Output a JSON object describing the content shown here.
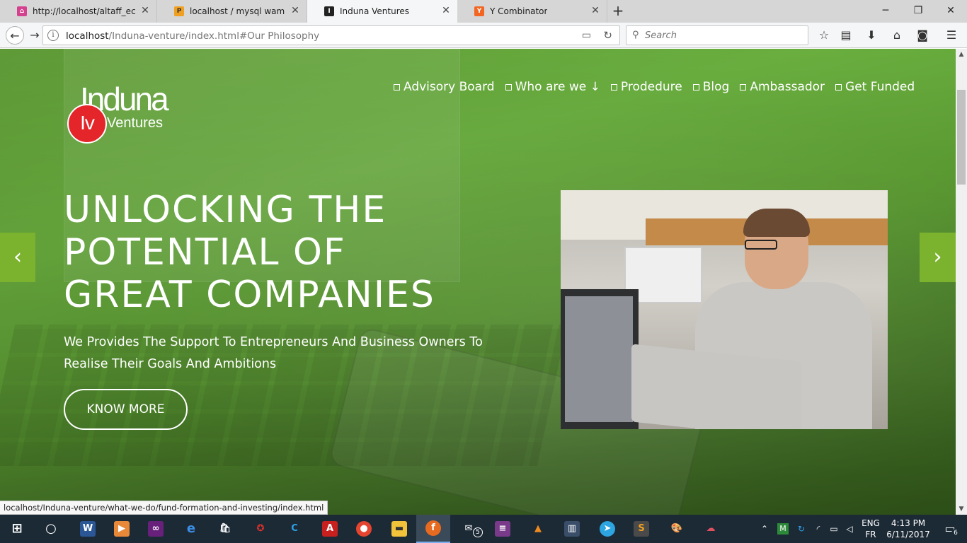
{
  "browser": {
    "tabs": [
      {
        "label": "http://localhost/altaff_ecom",
        "favicon": "app-icon",
        "color": "#d4418e",
        "active": false
      },
      {
        "label": "localhost / mysql wampserv",
        "favicon": "phpmyadmin-icon",
        "color": "#f0a020",
        "active": false
      },
      {
        "label": "Induna Ventures",
        "favicon": "induna-icon",
        "color": "#222222",
        "active": true
      },
      {
        "label": "Y Combinator",
        "favicon": "ycombinator-icon",
        "color": "#f26522",
        "active": false
      }
    ],
    "new_tab_label": "+",
    "url_host": "localhost",
    "url_path": "/Induna-venture/index.html#Our Philosophy",
    "search_placeholder": "Search",
    "status_url": "localhost/Induna-venture/what-we-do/fund-formation-and-investing/index.html"
  },
  "site": {
    "logo_word": "Induna",
    "logo_sub": "Ventures",
    "logo_badge": "Iv",
    "nav": [
      {
        "label": "Advisory Board"
      },
      {
        "label": "Who are we ↓"
      },
      {
        "label": "Prodedure"
      },
      {
        "label": "Blog"
      },
      {
        "label": "Ambassador"
      },
      {
        "label": "Get Funded"
      }
    ],
    "hero_lines": [
      "UNLOCKING THE",
      "POTENTIAL OF",
      "GREAT COMPANIES"
    ],
    "hero_sub": "We Provides The Support To Entrepreneurs And Business Owners To Realise Their Goals And Ambitions",
    "cta_label": "KNOW MORE",
    "arrow_left": "‹",
    "arrow_right": "›"
  },
  "taskbar": {
    "apps": [
      "windows-start-icon",
      "cortana-icon",
      "word-icon",
      "media-player-icon",
      "visual-studio-icon",
      "edge-icon",
      "store-icon",
      "antivirus-icon",
      "ccleaner-icon",
      "acrobat-icon",
      "chrome-icon",
      "file-explorer-icon",
      "firefox-icon",
      "mail-icon",
      "winrar-icon",
      "vlc-icon",
      "app-icon",
      "telegram-icon",
      "sublime-icon",
      "paint-icon",
      "remote-icon"
    ],
    "mail_count": "5",
    "lang_top": "ENG",
    "lang_bottom": "FR",
    "time": "4:13 PM",
    "date": "6/11/2017",
    "notification_count": "6"
  },
  "colors": {
    "accent_green": "#7bb32e",
    "logo_red": "#e4262b"
  }
}
